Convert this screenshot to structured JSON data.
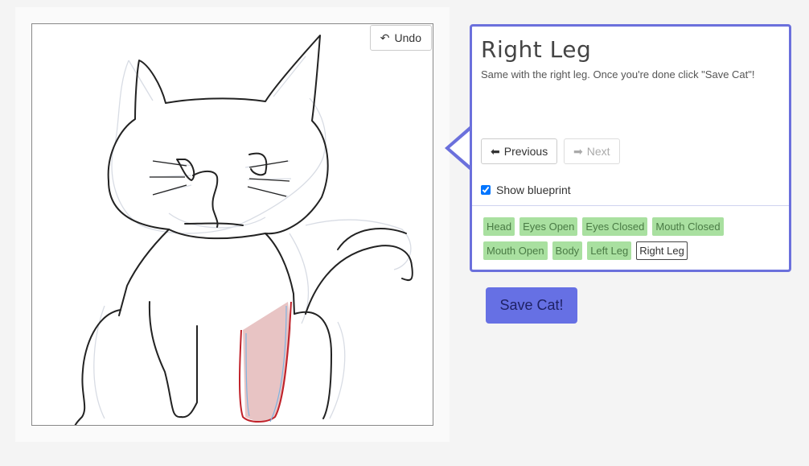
{
  "canvas": {
    "undo_label": "Undo",
    "undo_icon": "undo-arrow-icon"
  },
  "tutorial": {
    "title": "Right Leg",
    "description": "Same with the right leg. Once you're done click \"Save Cat\"!",
    "previous_label": "Previous",
    "next_label": "Next",
    "show_blueprint_label": "Show blueprint",
    "show_blueprint_checked": true,
    "parts": [
      {
        "label": "Head",
        "active": false
      },
      {
        "label": "Eyes Open",
        "active": false
      },
      {
        "label": "Eyes Closed",
        "active": false
      },
      {
        "label": "Mouth Closed",
        "active": false
      },
      {
        "label": "Mouth Open",
        "active": false
      },
      {
        "label": "Body",
        "active": false
      },
      {
        "label": "Left Leg",
        "active": false
      },
      {
        "label": "Right Leg",
        "active": true
      }
    ]
  },
  "save_label": "Save Cat!",
  "colors": {
    "accent": "#6b70dc",
    "save_button": "#6670e4",
    "chip": "#a9e0a0",
    "highlight_fill": "#e8c4c4",
    "highlight_stroke": "#c0222a"
  }
}
